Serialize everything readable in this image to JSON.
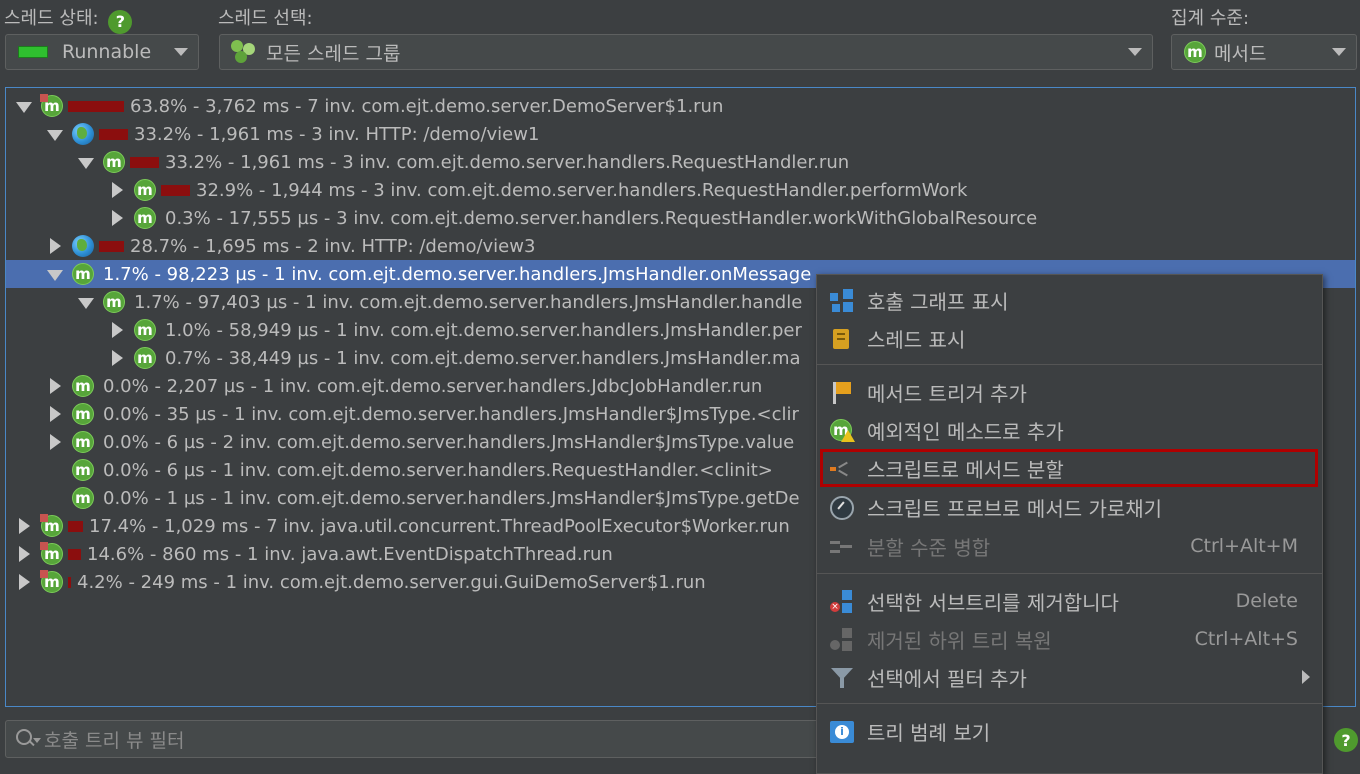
{
  "thread_state": {
    "label": "스레드 상태:",
    "value": "Runnable"
  },
  "thread_select": {
    "label": "스레드 선택:",
    "value": "모든 스레드 그룹"
  },
  "aggregation": {
    "label": "집계 수준:",
    "value": "메서드"
  },
  "colors": {
    "accent": "#4b6eaf",
    "bar": "#8b0e0e",
    "method_icon": "#57a53a",
    "highlight": "#b00000"
  },
  "tree": {
    "rows": [
      {
        "text": "63.8% - 3,762 ms - 7 inv. com.ejt.demo.server.DemoServer$1.run",
        "bar_fraction": 0.638
      },
      {
        "text": "33.2% - 1,961 ms - 3 inv. HTTP: /demo/view1",
        "bar_fraction": 0.332
      },
      {
        "text": "33.2% - 1,961 ms - 3 inv. com.ejt.demo.server.handlers.RequestHandler.run",
        "bar_fraction": 0.332
      },
      {
        "text": "32.9% - 1,944 ms - 3 inv. com.ejt.demo.server.handlers.RequestHandler.performWork",
        "bar_fraction": 0.329
      },
      {
        "text": "0.3% - 17,555 µs - 3 inv. com.ejt.demo.server.handlers.RequestHandler.workWithGlobalResource",
        "bar_fraction": 0.003
      },
      {
        "text": "28.7% - 1,695 ms - 2 inv. HTTP: /demo/view3",
        "bar_fraction": 0.287
      },
      {
        "text": "1.7% - 98,223 µs - 1 inv. com.ejt.demo.server.handlers.JmsHandler.onMessage",
        "bar_fraction": 0.017
      },
      {
        "text": "1.7% - 97,403 µs - 1 inv. com.ejt.demo.server.handlers.JmsHandler.handle",
        "bar_fraction": 0.017
      },
      {
        "text": "1.0% - 58,949 µs - 1 inv. com.ejt.demo.server.handlers.JmsHandler.per",
        "bar_fraction": 0.01
      },
      {
        "text": "0.7% - 38,449 µs - 1 inv. com.ejt.demo.server.handlers.JmsHandler.ma",
        "bar_fraction": 0.007
      },
      {
        "text": "0.0% - 2,207 µs - 1 inv. com.ejt.demo.server.handlers.JdbcJobHandler.run",
        "bar_fraction": 0.0
      },
      {
        "text": "0.0% - 35 µs - 1 inv. com.ejt.demo.server.handlers.JmsHandler$JmsType.<clir",
        "bar_fraction": 0.0
      },
      {
        "text": "0.0% - 6 µs - 2 inv. com.ejt.demo.server.handlers.JmsHandler$JmsType.value",
        "bar_fraction": 0.0
      },
      {
        "text": "0.0% - 6 µs - 1 inv. com.ejt.demo.server.handlers.RequestHandler.<clinit>",
        "bar_fraction": 0.0
      },
      {
        "text": "0.0% - 1 µs - 1 inv. com.ejt.demo.server.handlers.JmsHandler$JmsType.getDe",
        "bar_fraction": 0.0
      },
      {
        "text": "17.4% - 1,029 ms - 7 inv. java.util.concurrent.ThreadPoolExecutor$Worker.run",
        "bar_fraction": 0.174
      },
      {
        "text": "14.6% - 860 ms - 1 inv. java.awt.EventDispatchThread.run",
        "bar_fraction": 0.146
      },
      {
        "text": "4.2% - 249 ms - 1 inv. com.ejt.demo.server.gui.GuiDemoServer$1.run",
        "bar_fraction": 0.042
      }
    ]
  },
  "filter": {
    "placeholder": "호출 트리 뷰 필터"
  },
  "context_menu": {
    "items": [
      {
        "label": "호출 그래프 표시",
        "icon": "call-graph-icon"
      },
      {
        "label": "스레드 표시",
        "icon": "threads-icon"
      },
      {
        "label": "메서드 트리거 추가",
        "icon": "flag-icon"
      },
      {
        "label": "예외적인 메소드로 추가",
        "icon": "method-warning-icon"
      },
      {
        "label": "스크립트로 메서드 분할",
        "icon": "split-script-icon"
      },
      {
        "label": "스크립트 프로브로 메서드 가로채기",
        "icon": "probe-gauge-icon"
      },
      {
        "label": "분할 수준 병합",
        "shortcut": "Ctrl+Alt+M",
        "icon": "merge-icon"
      },
      {
        "label": "선택한 서브트리를 제거합니다",
        "shortcut": "Delete",
        "icon": "remove-subtree-icon"
      },
      {
        "label": "제거된 하위 트리 복원",
        "shortcut": "Ctrl+Alt+S",
        "icon": "restore-subtree-icon"
      },
      {
        "label": "선택에서 필터 추가",
        "icon": "filter-funnel-icon"
      },
      {
        "label": "트리 범례 보기",
        "icon": "legend-info-icon"
      }
    ]
  }
}
